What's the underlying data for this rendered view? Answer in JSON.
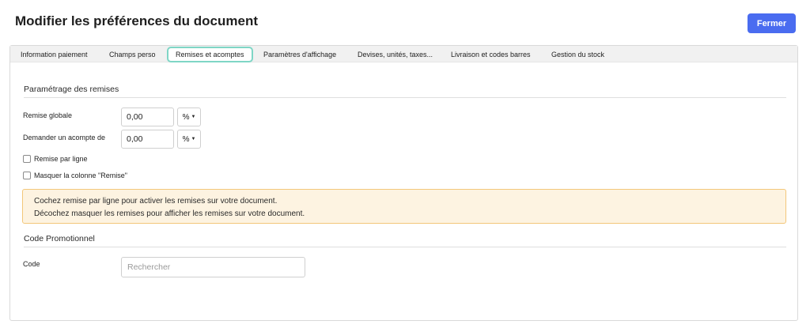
{
  "header": {
    "title": "Modifier les préférences du document",
    "close_label": "Fermer"
  },
  "tabs": [
    {
      "label": "Information paiement",
      "active": false
    },
    {
      "label": "Champs perso",
      "active": false
    },
    {
      "label": "Remises et acomptes",
      "active": true
    },
    {
      "label": "Paramètres d'affichage",
      "active": false
    },
    {
      "label": "Devises, unités, taxes...",
      "active": false
    },
    {
      "label": "Livraison et codes barres",
      "active": false
    },
    {
      "label": "Gestion du stock",
      "active": false
    }
  ],
  "discounts": {
    "section_title": "Paramétrage des remises",
    "global_discount": {
      "label": "Remise globale",
      "value": "0,00",
      "unit": "%"
    },
    "deposit": {
      "label": "Demander un acompte de",
      "value": "0,00",
      "unit": "%"
    },
    "per_line_label": "Remise par ligne",
    "per_line_checked": false,
    "hide_column_label": "Masquer la colonne \"Remise\"",
    "hide_column_checked": false
  },
  "alert": {
    "line1": "Cochez remise par ligne pour activer les remises sur votre document.",
    "line2": "Décochez masquer les remises pour afficher les remises sur votre document."
  },
  "promo": {
    "section_title": "Code Promotionnel",
    "code_label": "Code",
    "code_placeholder": "Rechercher",
    "code_value": ""
  },
  "colors": {
    "primary_button": "#4a6cf0",
    "active_tab_border": "#7fd6c6",
    "alert_background": "#fdf3e1",
    "alert_border": "#f3c77a"
  }
}
